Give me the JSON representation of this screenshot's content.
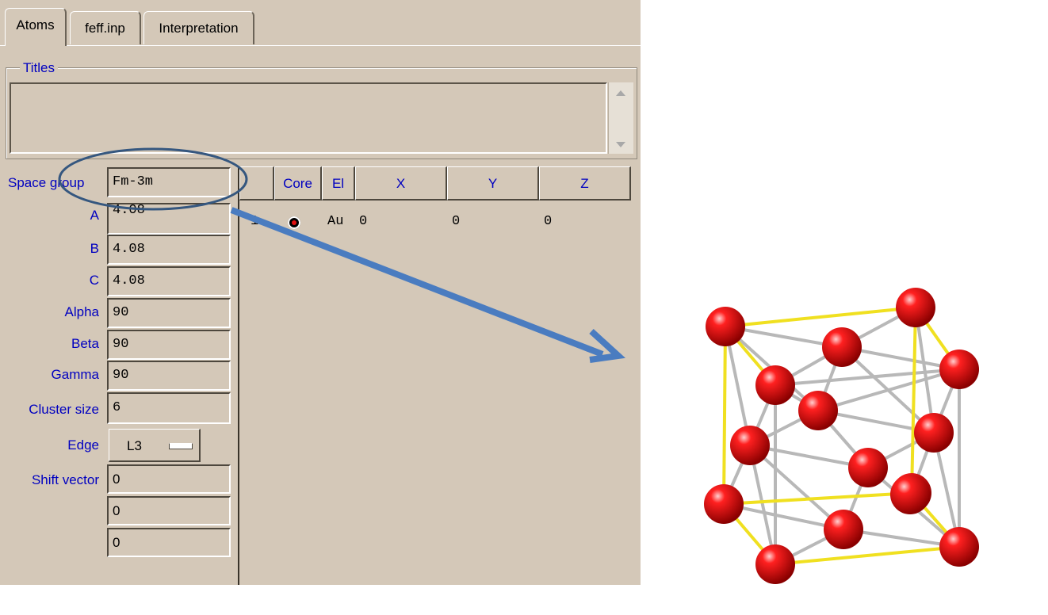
{
  "tabs": [
    {
      "label": "Atoms",
      "active": true
    },
    {
      "label": "feff.inp",
      "active": false
    },
    {
      "label": "Interpretation",
      "active": false
    }
  ],
  "titles": {
    "legend": "Titles",
    "value": ""
  },
  "crystal": {
    "space_group_label": "Space group",
    "space_group": "Fm-3m",
    "a_label": "A",
    "a": "4.08",
    "b_label": "B",
    "b": "4.08",
    "c_label": "C",
    "c": "4.08",
    "alpha_label": "Alpha",
    "alpha": "90",
    "beta_label": "Beta",
    "beta": "90",
    "gamma_label": "Gamma",
    "gamma": "90",
    "cluster_label": "Cluster size",
    "cluster": "6",
    "edge_label": "Edge",
    "edge": "L3",
    "shift_label": "Shift vector",
    "shift": [
      "0",
      "0",
      "0"
    ]
  },
  "atoms_table": {
    "headers": [
      "Core",
      "El",
      "X",
      "Y",
      "Z"
    ],
    "rows": [
      {
        "index": "1",
        "core": true,
        "el": "Au",
        "x": "0",
        "y": "0",
        "z": "0"
      }
    ]
  },
  "colors": {
    "label_blue": "#0000c0",
    "panel_bg": "#d4c8b8",
    "atom_red": "#e01010",
    "bond_yellow": "#f0e020",
    "arrow_blue": "#4a7cc0"
  }
}
